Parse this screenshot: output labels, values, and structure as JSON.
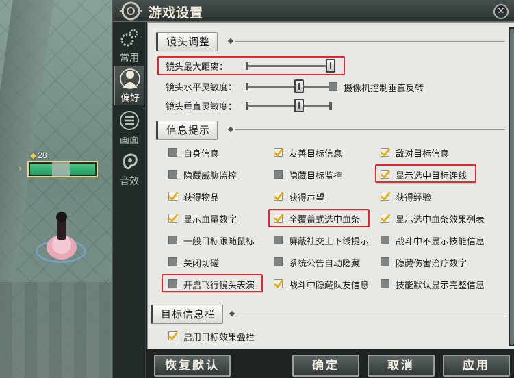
{
  "window": {
    "title": "游戏设置",
    "close_label": "✕"
  },
  "scene": {
    "level_text": "28",
    "level_icon": "drop-icon"
  },
  "tabs": [
    {
      "label": "常用",
      "icon": "gears-icon"
    },
    {
      "label": "偏好",
      "icon": "person-icon",
      "active": true
    },
    {
      "label": "画面",
      "icon": "scroll-icon"
    },
    {
      "label": "音效",
      "icon": "ear-icon"
    }
  ],
  "camera": {
    "section_title": "镜头调整",
    "max_distance": {
      "label": "镜头最大距离：",
      "value": 1.0
    },
    "horizontal_sensitivity": {
      "label": "镜头水平灵敏度：",
      "value": 0.6
    },
    "vertical_sensitivity": {
      "label": "镜头垂直灵敏度：",
      "value": 0.6
    },
    "invert_vertical": {
      "label": "摄像机控制垂直反转",
      "checked": false
    }
  },
  "info": {
    "section_title": "信息提示",
    "items": [
      {
        "label": "自身信息",
        "checked": false
      },
      {
        "label": "友善目标信息",
        "checked": true
      },
      {
        "label": "敌对目标信息",
        "checked": true
      },
      {
        "label": "隐藏威胁监控",
        "checked": false
      },
      {
        "label": "隐藏目标监控",
        "checked": false
      },
      {
        "label": "显示选中目标连线",
        "checked": true
      },
      {
        "label": "获得物品",
        "checked": true
      },
      {
        "label": "获得声望",
        "checked": true
      },
      {
        "label": "获得经验",
        "checked": true
      },
      {
        "label": "显示血量数字",
        "checked": true
      },
      {
        "label": "全覆盖式选中血条",
        "checked": true
      },
      {
        "label": "显示选中血条效果列表",
        "checked": true
      },
      {
        "label": "一般目标跟随鼠标",
        "checked": false
      },
      {
        "label": "屏蔽社交上下线提示",
        "checked": false
      },
      {
        "label": "战斗中不显示技能信息",
        "checked": false
      },
      {
        "label": "关闭切磋",
        "checked": false
      },
      {
        "label": "系统公告自动隐藏",
        "checked": false
      },
      {
        "label": "隐藏伤害治疗数字",
        "checked": false
      },
      {
        "label": "开启飞行镜头表演",
        "checked": false
      },
      {
        "label": "战斗中隐藏队友信息",
        "checked": true
      },
      {
        "label": "技能默认显示完整信息",
        "checked": false
      }
    ]
  },
  "target_info": {
    "section_title": "目标信息栏",
    "items": [
      {
        "label": "启用目标效果叠栏",
        "checked": true
      }
    ]
  },
  "footer": {
    "reset_label": "恢复默认",
    "ok_label": "确定",
    "cancel_label": "取消",
    "apply_label": "应用"
  },
  "colors": {
    "highlight": "#e5262b",
    "check": "#e0b020"
  }
}
